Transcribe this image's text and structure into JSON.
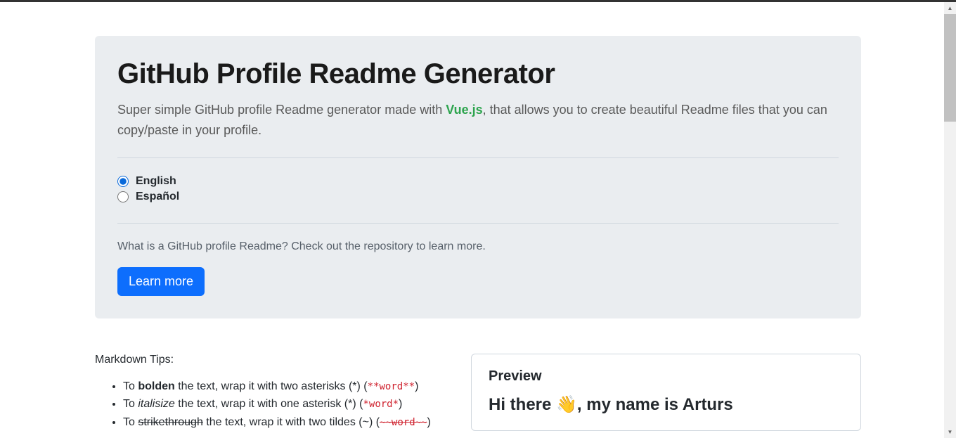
{
  "header": {
    "title": "GitHub Profile Readme Generator",
    "subtitle_before": "Super simple GitHub profile Readme generator made with ",
    "vue_link": "Vue.js",
    "subtitle_after": ", that allows you to create beautiful Readme files that you can copy/paste in your profile."
  },
  "languages": {
    "english": "English",
    "spanish": "Español"
  },
  "learn": {
    "text": "What is a GitHub profile Readme? Check out the repository to learn more.",
    "button": "Learn more"
  },
  "tips": {
    "heading": "Markdown Tips:",
    "bold": {
      "prefix": "To ",
      "emphasis": "bolden",
      "middle": " the text, wrap it with two asterisks (*) (",
      "code": "**word**",
      "suffix": ")"
    },
    "italic": {
      "prefix": "To ",
      "emphasis": "italisize",
      "middle": " the text, wrap it with one asterisk (*) (",
      "code": "*word*",
      "suffix": ")"
    },
    "strike": {
      "prefix": "To ",
      "emphasis": "strikethrough",
      "middle": " the text, wrap it with two tildes (~) (",
      "code": "~~word~~",
      "suffix": ")"
    }
  },
  "preview": {
    "heading": "Preview",
    "greeting_before": "Hi there ",
    "greeting_emoji": "👋",
    "greeting_after": ", my name is Arturs"
  }
}
